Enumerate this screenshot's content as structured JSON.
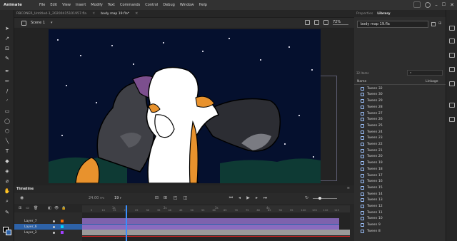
{
  "app": {
    "name": "Animate"
  },
  "menu": [
    "File",
    "Edit",
    "View",
    "Insert",
    "Modify",
    "Text",
    "Commands",
    "Control",
    "Debug",
    "Window",
    "Help"
  ],
  "documents": [
    {
      "label": "RBCONER_Untitled-1_20200415101957.fla",
      "active": false
    },
    {
      "label": "body map 19.fla*",
      "active": true
    }
  ],
  "scene": {
    "label": "Scene 1"
  },
  "zoom": {
    "value": "72%"
  },
  "timeline": {
    "title": "Timeline",
    "fps": "24.00",
    "fps_unit": "FPS",
    "current_frame": "19",
    "current_frame_suffix": "F",
    "ruler_numbers": [
      "5",
      "10",
      "15",
      "20",
      "25",
      "30",
      "35",
      "40",
      "45",
      "50",
      "55",
      "60",
      "65",
      "70",
      "75",
      "80",
      "85",
      "90",
      "95",
      "100",
      "105",
      "110",
      "115"
    ],
    "seconds_markers": [
      "1s",
      "2s",
      "3s",
      "4s"
    ],
    "layers": [
      {
        "name": "Layer_7",
        "selected": false,
        "color": "#ff6a00"
      },
      {
        "name": "Layer_6",
        "selected": true,
        "color": "#00d4ff"
      },
      {
        "name": "Layer_2",
        "selected": false,
        "color": "#a040ff"
      }
    ]
  },
  "right_panel": {
    "tabs": [
      "Properties",
      "Library"
    ],
    "active_tab": "Library",
    "document_select": "body map 19.fla",
    "item_count": "32 items",
    "search_placeholder": "",
    "col_name": "Name",
    "col_linkage": "Linkage",
    "items": [
      "Tween 32",
      "Tween 30",
      "Tween 29",
      "Tween 28",
      "Tween 27",
      "Tween 26",
      "Tween 25",
      "Tween 24",
      "Tween 23",
      "Tween 22",
      "Tween 21",
      "Tween 20",
      "Tween 19",
      "Tween 18",
      "Tween 17",
      "Tween 16",
      "Tween 15",
      "Tween 14",
      "Tween 13",
      "Tween 12",
      "Tween 11",
      "Tween 10",
      "Tween 9",
      "Tween 8"
    ]
  },
  "colors": {
    "stage_bg": "#05102e",
    "accent": "#2d62a8",
    "playhead": "#3a8fff",
    "tween_track": "#8a6bbf"
  }
}
